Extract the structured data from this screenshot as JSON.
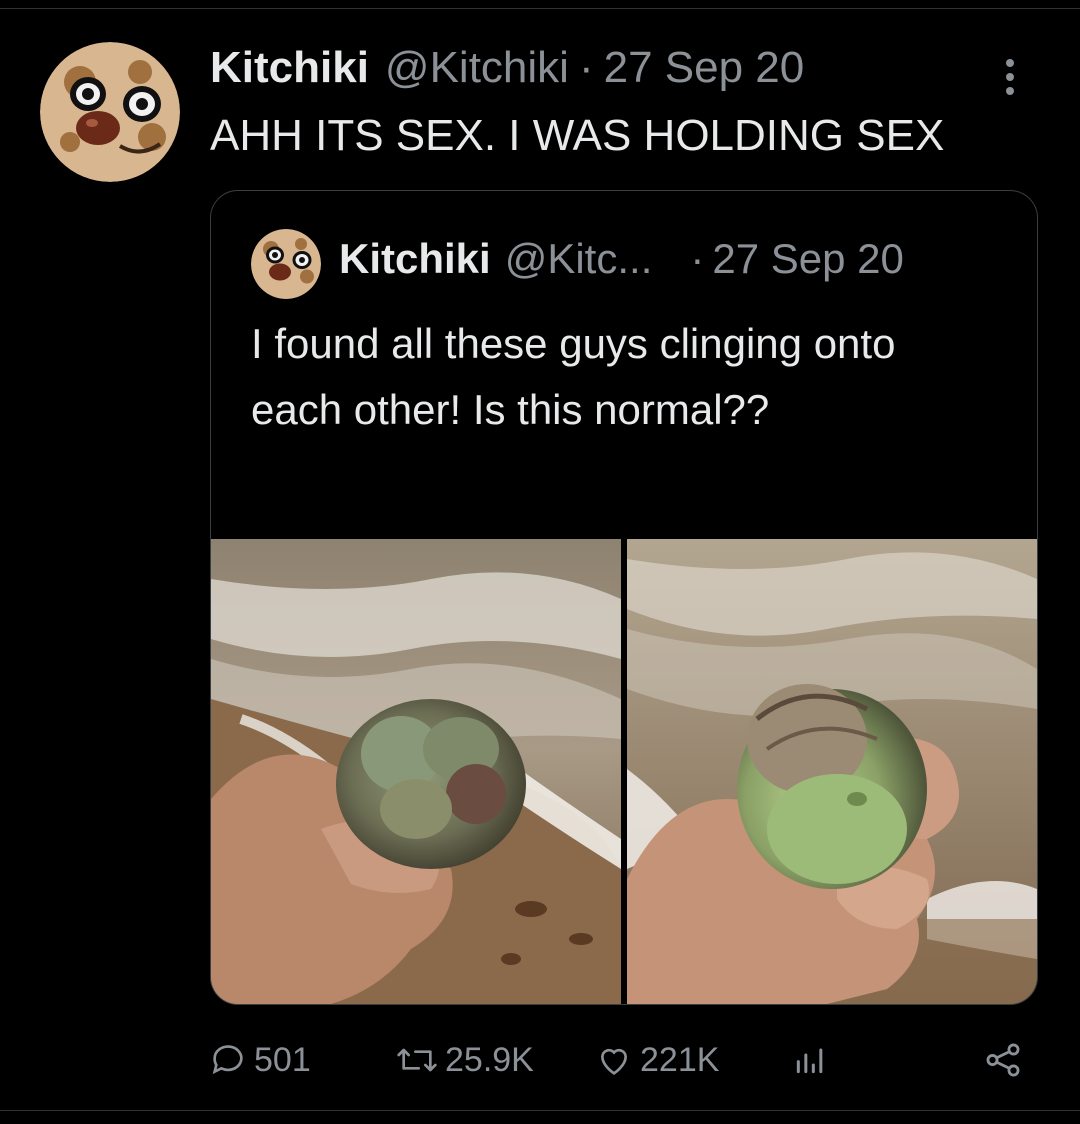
{
  "tweet": {
    "author_name": "Kitchiki",
    "author_handle": "@Kitchiki",
    "separator": "·",
    "date": "27 Sep 20",
    "text": "AHH ITS SEX. I WAS HOLDING SEX",
    "more_icon": "more-vertical-icon"
  },
  "quoted_tweet": {
    "author_name": "Kitchiki",
    "author_handle": "@Kitc...",
    "separator": "·",
    "date": "27 Sep 20",
    "text": "I found all these guys clinging onto each other! Is this normal??"
  },
  "actions": {
    "replies": "501",
    "retweets": "25.9K",
    "likes": "221K",
    "reply_icon": "reply-icon",
    "retweet_icon": "retweet-icon",
    "like_icon": "heart-icon",
    "views_icon": "views-icon",
    "share_icon": "share-icon"
  },
  "colors": {
    "background": "#000000",
    "text": "#e7e9ea",
    "muted": "#8b9197",
    "border": "#2f3336"
  }
}
